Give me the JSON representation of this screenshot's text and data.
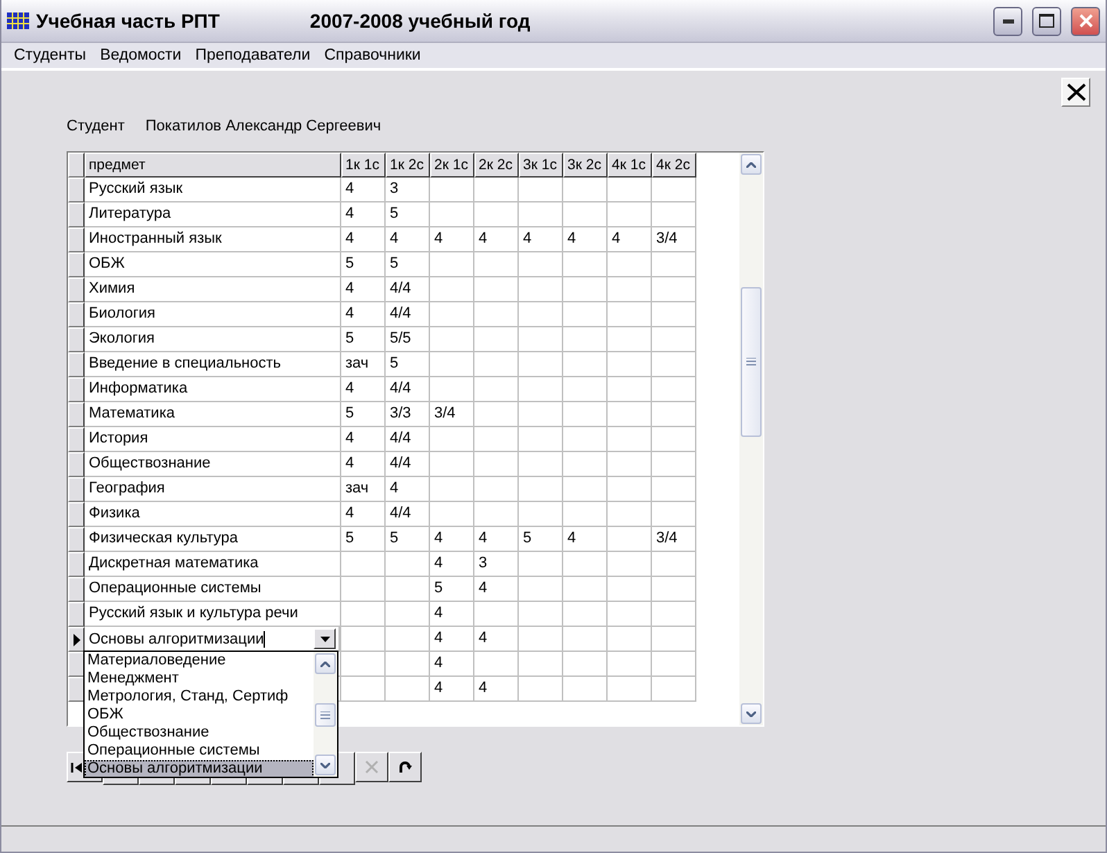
{
  "window": {
    "title": "Учебная часть РПТ",
    "subtitle": "2007-2008 учебный год"
  },
  "menu": [
    "Студенты",
    "Ведомости",
    "Преподаватели",
    "Справочники"
  ],
  "student": {
    "label": "Студент",
    "name": "Покатилов Александр Сергеевич"
  },
  "table": {
    "columns": [
      "предмет",
      "1к 1с",
      "1к 2с",
      "2к 1с",
      "2к 2с",
      "3к 1с",
      "3к 2с",
      "4к 1с",
      "4к 2с"
    ],
    "rows": [
      {
        "current": false,
        "subject": "Русский язык",
        "grades": {
          "1к 1с": "4",
          "1к 2с": "3"
        }
      },
      {
        "current": false,
        "subject": "Литература",
        "grades": {
          "1к 1с": "4",
          "1к 2с": "5"
        }
      },
      {
        "current": false,
        "subject": "Иностранный язык",
        "grades": {
          "1к 1с": "4",
          "1к 2с": "4",
          "2к 1с": "4",
          "2к 2с": "4",
          "3к 1с": "4",
          "3к 2с": "4",
          "4к 1с": "4",
          "4к 2с": "3/4"
        }
      },
      {
        "current": false,
        "subject": "ОБЖ",
        "grades": {
          "1к 1с": "5",
          "1к 2с": "5"
        }
      },
      {
        "current": false,
        "subject": "Химия",
        "grades": {
          "1к 1с": "4",
          "1к 2с": "4/4"
        }
      },
      {
        "current": false,
        "subject": "Биология",
        "grades": {
          "1к 1с": "4",
          "1к 2с": "4/4"
        }
      },
      {
        "current": false,
        "subject": "Экология",
        "grades": {
          "1к 1с": "5",
          "1к 2с": "5/5"
        }
      },
      {
        "current": false,
        "subject": "Введение в специальность",
        "grades": {
          "1к 1с": "зач",
          "1к 2с": "5"
        }
      },
      {
        "current": false,
        "subject": "Информатика",
        "grades": {
          "1к 1с": "4",
          "1к 2с": "4/4"
        }
      },
      {
        "current": false,
        "subject": "Математика",
        "grades": {
          "1к 1с": "5",
          "1к 2с": "3/3",
          "2к 1с": "3/4"
        }
      },
      {
        "current": false,
        "subject": "История",
        "grades": {
          "1к 1с": "4",
          "1к 2с": "4/4"
        }
      },
      {
        "current": false,
        "subject": "Обществознание",
        "grades": {
          "1к 1с": "4",
          "1к 2с": "4/4"
        }
      },
      {
        "current": false,
        "subject": "География",
        "grades": {
          "1к 1с": "зач",
          "1к 2с": "4"
        }
      },
      {
        "current": false,
        "subject": "Физика",
        "grades": {
          "1к 1с": "4",
          "1к 2с": "4/4"
        }
      },
      {
        "current": false,
        "subject": "Физическая культура",
        "grades": {
          "1к 1с": "5",
          "1к 2с": "5",
          "2к 1с": "4",
          "2к 2с": "4",
          "3к 1с": "5",
          "3к 2с": "4",
          "4к 2с": "3/4"
        }
      },
      {
        "current": false,
        "subject": "Дискретная математика",
        "grades": {
          "2к 1с": "4",
          "2к 2с": "3"
        }
      },
      {
        "current": false,
        "subject": "Операционные системы",
        "grades": {
          "2к 1с": "5",
          "2к 2с": "4"
        }
      },
      {
        "current": false,
        "subject": "Русский язык и культура речи",
        "grades": {
          "2к 1с": "4"
        }
      },
      {
        "current": true,
        "subject": "Основы алгоритмизации",
        "grades": {
          "2к 1с": "4",
          "2к 2с": "4"
        }
      },
      {
        "current": false,
        "grades": {
          "2к 1с": "4"
        }
      },
      {
        "current": false,
        "grades": {
          "2к 1с": "4",
          "2к 2с": "4"
        }
      }
    ],
    "dropdown": {
      "options": [
        {
          "label": "Материаловедение",
          "selected": false
        },
        {
          "label": "Менеджмент",
          "selected": false
        },
        {
          "label": "Метрология, Станд, Сертиф",
          "selected": false
        },
        {
          "label": "ОБЖ",
          "selected": false
        },
        {
          "label": "Обществознание",
          "selected": false
        },
        {
          "label": "Операционные системы",
          "selected": false
        },
        {
          "label": "Основы алгоритмизации",
          "selected": true
        }
      ]
    }
  },
  "navigator": {
    "buttons": [
      {
        "kind": "first",
        "disabled": false
      },
      {
        "kind": "cancel",
        "disabled": true
      },
      {
        "kind": "refresh",
        "disabled": false
      }
    ]
  }
}
